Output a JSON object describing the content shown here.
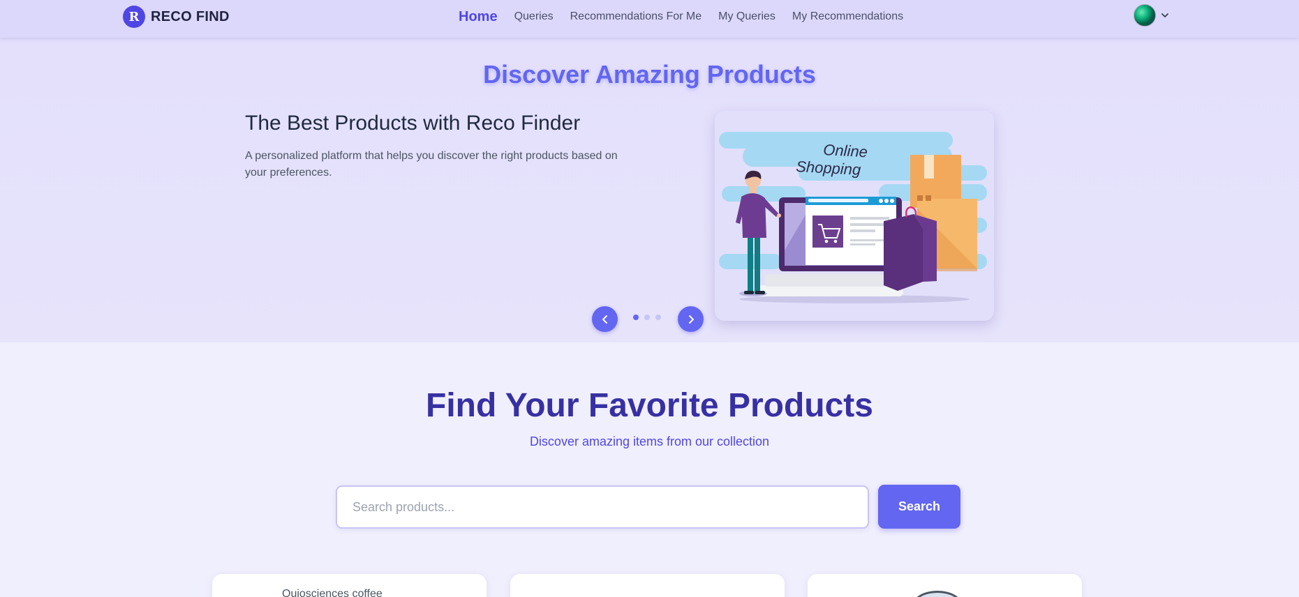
{
  "brand": {
    "badge": "R",
    "name": "RECO FIND"
  },
  "nav": {
    "items": [
      {
        "label": "Home",
        "active": true
      },
      {
        "label": "Queries",
        "active": false
      },
      {
        "label": "Recommendations For Me",
        "active": false
      },
      {
        "label": "My Queries",
        "active": false
      },
      {
        "label": "My Recommendations",
        "active": false
      }
    ]
  },
  "user": {
    "avatar_icon": "user-avatar",
    "menu_icon": "chevron-down-icon"
  },
  "hero": {
    "title": "Discover Amazing Products",
    "slide": {
      "heading": "The Best Products with Reco Finder",
      "description": "A personalized platform that helps you discover the right products based on your preferences.",
      "image_caption": "Online Shopping"
    },
    "carousel": {
      "slide_count": 3,
      "active_index": 0,
      "prev_icon": "chevron-left-icon",
      "next_icon": "chevron-right-icon"
    }
  },
  "search_section": {
    "title": "Find Your Favorite Products",
    "subtitle": "Discover amazing items from our collection",
    "input_placeholder": "Search products...",
    "input_value": "",
    "button_label": "Search"
  },
  "product_cards": [
    {
      "image_alt": "Quiosciences coffee"
    },
    {
      "image_alt": ""
    },
    {
      "image_alt": ""
    }
  ],
  "colors": {
    "accent": "#6366f1",
    "accent_dark": "#3730a3",
    "navbar_bg": "#dcd8fb",
    "hero_bg": "#e4e0fc",
    "page_bg": "#f0effd"
  }
}
